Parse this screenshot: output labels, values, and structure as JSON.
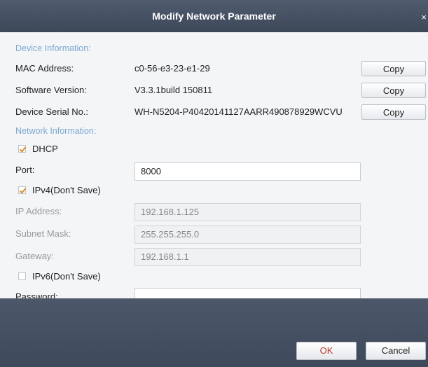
{
  "dialog": {
    "title": "Modify Network Parameter",
    "close_glyph": "×"
  },
  "device_info": {
    "section_label": "Device Information:",
    "rows": [
      {
        "label": "MAC Address:",
        "value": "c0-56-e3-23-e1-29",
        "button": "Copy"
      },
      {
        "label": "Software Version:",
        "value": "V3.3.1build 150811",
        "button": "Copy"
      },
      {
        "label": "Device Serial No.:",
        "value": "WH-N5204-P40420141127AARR490878929WCVU",
        "button": "Copy"
      }
    ]
  },
  "network_info": {
    "section_label": "Network Information:",
    "dhcp": {
      "label": "DHCP",
      "checked": true
    },
    "port": {
      "label": "Port:",
      "value": "8000"
    },
    "ipv4": {
      "label": "IPv4(Don't Save)",
      "checked": true
    },
    "ip_address": {
      "label": "IP Address:",
      "value": "192.168.1.125"
    },
    "subnet_mask": {
      "label": "Subnet Mask:",
      "value": "255.255.255.0"
    },
    "gateway": {
      "label": "Gateway:",
      "value": "192.168.1.1"
    },
    "ipv6": {
      "label": "IPv6(Don't Save)",
      "checked": false
    },
    "password": {
      "label": "Password:",
      "value": ""
    }
  },
  "footer": {
    "ok_label": "OK",
    "cancel_label": "Cancel",
    "ok_text_color": "#c0392b"
  }
}
